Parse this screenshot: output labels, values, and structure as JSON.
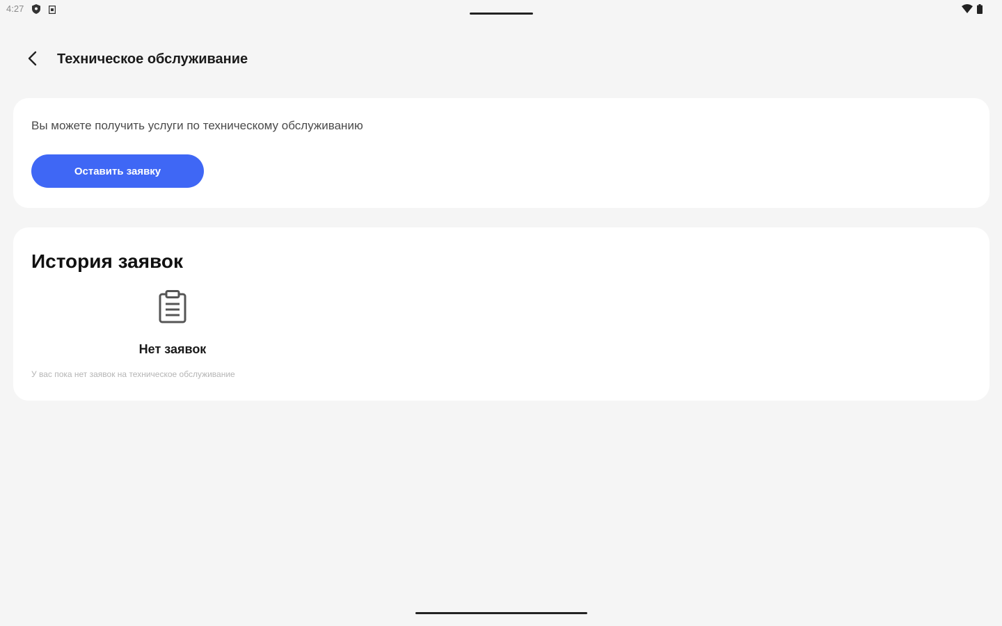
{
  "status_bar": {
    "time": "4:27",
    "left_icons": [
      "shield-icon",
      "sim-icon"
    ],
    "right_icons": [
      "wifi-icon",
      "battery-icon"
    ]
  },
  "header": {
    "back_icon": "chevron-left-icon",
    "title": "Техническое обслуживание"
  },
  "service_card": {
    "text": "Вы можете получить услуги по техническому обслуживанию",
    "button_label": "Оставить заявку"
  },
  "history_card": {
    "title": "История заявок",
    "empty_icon": "clipboard-icon",
    "empty_title": "Нет заявок",
    "empty_subtitle": "У вас пока нет заявок на техническое обслуживание"
  },
  "colors": {
    "accent": "#3f67f5",
    "background": "#f5f5f5",
    "card": "#ffffff"
  }
}
